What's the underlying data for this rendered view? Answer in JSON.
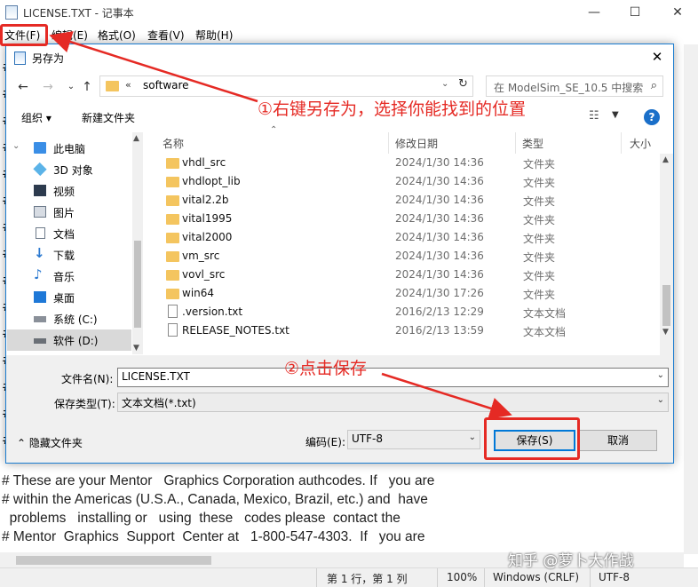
{
  "notepad": {
    "title": "LICENSE.TXT - 记事本",
    "menu": [
      "文件(F)",
      "编辑(E)",
      "格式(O)",
      "查看(V)",
      "帮助(H)"
    ],
    "hash": "#",
    "text_lines": [
      "# These are your Mentor   Graphics Corporation authcodes. If   you are",
      "# within the Americas (U.S.A., Canada, Mexico, Brazil, etc.) and  have",
      "  problems   installing or   using  these   codes please  contact the",
      "# Mentor  Graphics  Support  Center at   1-800-547-4303.  If   you are"
    ],
    "status": {
      "position": "第 1 行，第 1 列",
      "zoom": "100%",
      "line_ending": "Windows (CRLF)",
      "encoding": "UTF-8"
    },
    "watermark": "知乎 @萝卜大作战"
  },
  "dialog": {
    "title": "另存为",
    "address_chevron": "«",
    "address": "software",
    "search_placeholder": "在 ModelSim_SE_10.5 中搜索",
    "toolbar": {
      "organize": "组织 ▾",
      "new_folder": "新建文件夹"
    },
    "nav_items": [
      {
        "label": "此电脑",
        "icon": "computer-icon"
      },
      {
        "label": "3D 对象",
        "icon": "cube-icon"
      },
      {
        "label": "视频",
        "icon": "video-icon"
      },
      {
        "label": "图片",
        "icon": "picture-icon"
      },
      {
        "label": "文档",
        "icon": "document-icon"
      },
      {
        "label": "下载",
        "icon": "download-icon"
      },
      {
        "label": "音乐",
        "icon": "music-icon"
      },
      {
        "label": "桌面",
        "icon": "desktop-icon"
      },
      {
        "label": "系统 (C:)",
        "icon": "drive-icon"
      },
      {
        "label": "软件 (D:)",
        "icon": "drive-icon"
      }
    ],
    "columns": {
      "name": "名称",
      "date": "修改日期",
      "type": "类型",
      "size": "大小"
    },
    "files": [
      {
        "name": "vhdl_src",
        "date": "2024/1/30 14:36",
        "type": "文件夹",
        "kind": "folder"
      },
      {
        "name": "vhdlopt_lib",
        "date": "2024/1/30 14:36",
        "type": "文件夹",
        "kind": "folder"
      },
      {
        "name": "vital2.2b",
        "date": "2024/1/30 14:36",
        "type": "文件夹",
        "kind": "folder"
      },
      {
        "name": "vital1995",
        "date": "2024/1/30 14:36",
        "type": "文件夹",
        "kind": "folder"
      },
      {
        "name": "vital2000",
        "date": "2024/1/30 14:36",
        "type": "文件夹",
        "kind": "folder"
      },
      {
        "name": "vm_src",
        "date": "2024/1/30 14:36",
        "type": "文件夹",
        "kind": "folder"
      },
      {
        "name": "vovl_src",
        "date": "2024/1/30 14:36",
        "type": "文件夹",
        "kind": "folder"
      },
      {
        "name": "win64",
        "date": "2024/1/30 17:26",
        "type": "文件夹",
        "kind": "folder"
      },
      {
        "name": ".version.txt",
        "date": "2016/2/13 12:29",
        "type": "文本文档",
        "kind": "file"
      },
      {
        "name": "RELEASE_NOTES.txt",
        "date": "2016/2/13 13:59",
        "type": "文本文档",
        "kind": "file"
      }
    ],
    "filename_label": "文件名(N):",
    "filename_value": "LICENSE.TXT",
    "filetype_label": "保存类型(T):",
    "filetype_value": "文本文档(*.txt)",
    "hide_folders": "隐藏文件夹",
    "encoding_label": "编码(E):",
    "encoding_value": "UTF-8",
    "save_button": "保存(S)",
    "cancel_button": "取消"
  },
  "annotations": {
    "step1": "①右键另存为，选择你能找到的位置",
    "step2": "②点击保存",
    "color": "#e52a24"
  }
}
